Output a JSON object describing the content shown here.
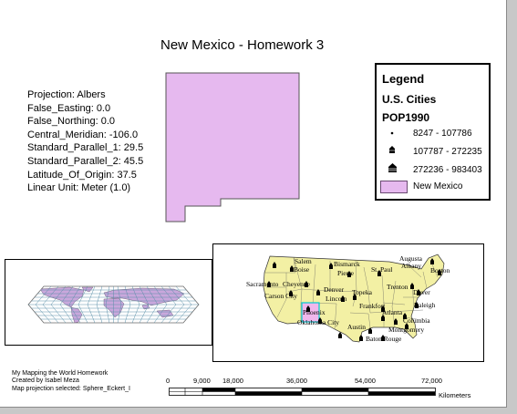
{
  "title": "New Mexico - Homework 3",
  "projection": {
    "lines": [
      "Projection: Albers",
      "False_Easting: 0.0",
      "False_Northing: 0.0",
      "Central_Meridian: -106.0",
      "Standard_Parallel_1: 29.5",
      "Standard_Parallel_2: 45.5",
      "Latitude_Of_Origin: 37.5",
      "Linear Unit: Meter (1.0)"
    ]
  },
  "legend": {
    "title": "Legend",
    "layer": "U.S. Cities",
    "field": "POP1990",
    "classes": [
      {
        "label": "8247 - 107786",
        "symbol": "small-dot"
      },
      {
        "label": "107787 - 272235",
        "symbol": "medium-building-icon"
      },
      {
        "label": "272236 - 983403",
        "symbol": "large-building-icon"
      }
    ],
    "state_label": "New Mexico",
    "state_color": "#e6b9ef"
  },
  "us_map": {
    "land_color": "#f3f0a4",
    "cities": [
      "Salem",
      "Boise",
      "Bismarck",
      "Pierre",
      "St. Paul",
      "Augusta",
      "Albany",
      "Boston",
      "Sacramento",
      "Cheyenne",
      "Carson City",
      "Denver",
      "Lincoln",
      "Topeka",
      "Trenton",
      "Dover",
      "Phoenix",
      "Oklahoma City",
      "Frankfort",
      "Raleigh",
      "Atlanta",
      "Columbia",
      "Austin",
      "Montgomery",
      "Baton Rouge"
    ]
  },
  "footer": {
    "lines": [
      "My Mapping the World Homework",
      "Created by Isabel Meza",
      "Map projection selected: Sphere_Eckert_I"
    ]
  },
  "scale": {
    "ticks": [
      "0",
      "9,000",
      "18,000",
      "36,000",
      "54,000",
      "72,000"
    ],
    "unit": "Kilometers"
  }
}
